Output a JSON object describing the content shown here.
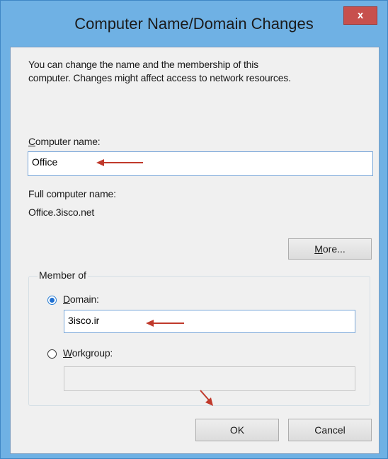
{
  "window": {
    "title": "Computer Name/Domain Changes",
    "close_glyph": "x"
  },
  "description": {
    "line1": "You can change the name and the membership of this",
    "line2": "computer. Changes might affect access to network resources."
  },
  "computer_name": {
    "label_mnemonic": "C",
    "label_rest": "omputer name:",
    "value": "Office"
  },
  "full_name": {
    "label": "Full computer name:",
    "value": "Office.3isco.net"
  },
  "more_button": {
    "mnemonic": "M",
    "rest": "ore..."
  },
  "member_of": {
    "label": "Member of",
    "domain": {
      "mnemonic": "D",
      "rest": "omain:",
      "value": "3isco.ir",
      "checked": true
    },
    "workgroup": {
      "mnemonic": "W",
      "rest": "orkgroup:",
      "value": "",
      "checked": false
    }
  },
  "buttons": {
    "ok": "OK",
    "cancel": "Cancel"
  },
  "annotation_color": "#c0392b",
  "colors": {
    "titlebar": "#6fb1e4",
    "close_button": "#c7504d",
    "dialog_background": "#f0f0f0"
  }
}
